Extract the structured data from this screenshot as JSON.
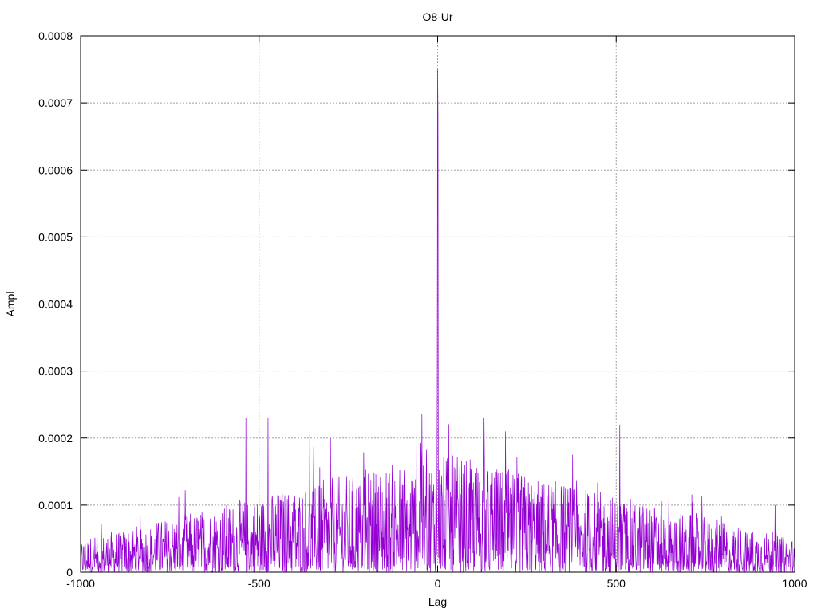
{
  "chart_data": {
    "type": "line",
    "title": "O8-Ur",
    "xlabel": "Lag",
    "ylabel": "Ampl",
    "xlim": [
      -1000,
      1000
    ],
    "ylim": [
      0,
      0.0008
    ],
    "grid": true,
    "x_ticks": [
      -1000,
      -500,
      0,
      500,
      1000
    ],
    "x_tick_labels": [
      "-1000",
      "-500",
      "0",
      "500",
      "1000"
    ],
    "y_ticks": [
      0,
      0.0001,
      0.0002,
      0.0003,
      0.0004,
      0.0005,
      0.0006,
      0.0007,
      0.0008
    ],
    "y_tick_labels": [
      "0",
      "0.0001",
      "0.0002",
      "0.0003",
      "0.0004",
      "0.0005",
      "0.0006",
      "0.0007",
      "0.0008"
    ],
    "series": [
      {
        "color": "#9400d3",
        "lag_range": [
          -1000,
          1000
        ],
        "lag_step": 1,
        "envelope": {
          "description": "triangular noise envelope, peak near lag 0",
          "edge_typical_max": 5e-05,
          "center_typical_max": 0.00018
        },
        "spikes": [
          {
            "x": 0,
            "y": 0.00075
          },
          {
            "x": 1,
            "y": 0.00068
          },
          {
            "x": -1,
            "y": 0.00029
          },
          {
            "x": -537,
            "y": 0.00023
          },
          {
            "x": -475,
            "y": 0.00023
          },
          {
            "x": -358,
            "y": 0.00021
          },
          {
            "x": -300,
            "y": 0.0002
          },
          {
            "x": -60,
            "y": 0.0002
          },
          {
            "x": 40,
            "y": 0.00023
          },
          {
            "x": 130,
            "y": 0.00023
          },
          {
            "x": 190,
            "y": 0.00021
          },
          {
            "x": 510,
            "y": 0.00022
          },
          {
            "x": 945,
            "y": 0.0001
          }
        ]
      }
    ]
  }
}
